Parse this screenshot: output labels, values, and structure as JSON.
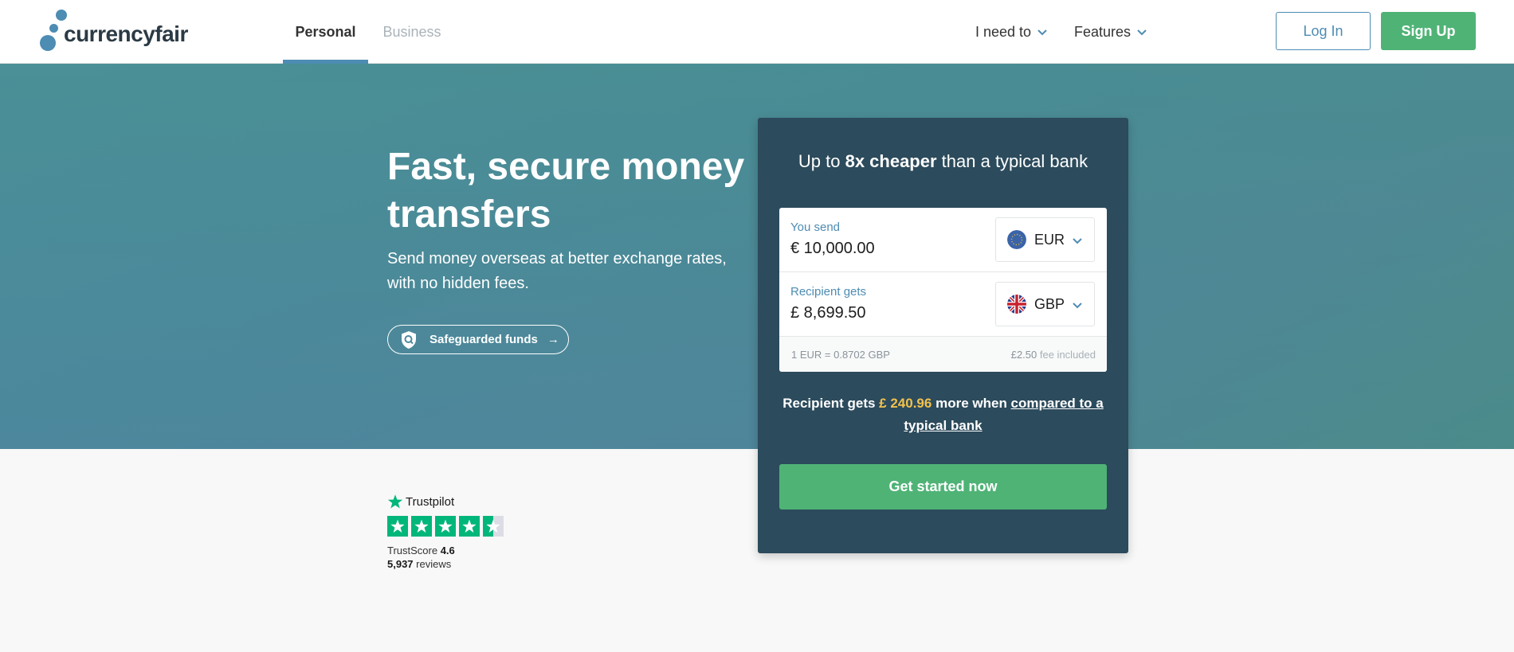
{
  "header": {
    "logo_text": "currencyfair",
    "tabs": [
      {
        "label": "Personal",
        "active": true
      },
      {
        "label": "Business",
        "active": false
      }
    ],
    "nav": [
      {
        "label": "I need to",
        "icon": "chevron-down-icon"
      },
      {
        "label": "Features",
        "icon": "chevron-down-icon"
      }
    ],
    "login_label": "Log In",
    "signup_label": "Sign Up"
  },
  "hero": {
    "title": "Fast, secure money transfers",
    "subtitle": "Send money overseas at better exchange rates, with no hidden fees.",
    "safeguard_label": "Safeguarded funds",
    "safeguard_icon": "shield-icon",
    "safeguard_arrow": "→"
  },
  "calculator": {
    "headline_prefix": "Up to ",
    "headline_bold": "8x cheaper",
    "headline_suffix": " than a typical bank",
    "send": {
      "label": "You send",
      "amount": "€ 10,000.00",
      "currency": "EUR",
      "flag_icon": "eu-flag-icon"
    },
    "receive": {
      "label": "Recipient gets",
      "amount": "£ 8,699.50",
      "currency": "GBP",
      "flag_icon": "uk-flag-icon"
    },
    "rate": "1 EUR = 0.8702 GBP",
    "fee_amount": "£2.50",
    "fee_text": " fee included",
    "compare_prefix": "Recipient gets ",
    "compare_amount": "£ 240.96",
    "compare_middle": " more when ",
    "compare_link": "compared to a typical bank",
    "cta_label": "Get started now"
  },
  "trustpilot": {
    "brand": "Trustpilot",
    "rating": 4.6,
    "score_label": "TrustScore ",
    "score_value": "4.6",
    "reviews_count": "5,937",
    "reviews_label": " reviews"
  },
  "colors": {
    "brand_blue": "#4d8cb3",
    "brand_green": "#4fb376",
    "card_bg": "#2c4b5c",
    "highlight_gold": "#f2c14e",
    "trustpilot_green": "#00b67a"
  }
}
